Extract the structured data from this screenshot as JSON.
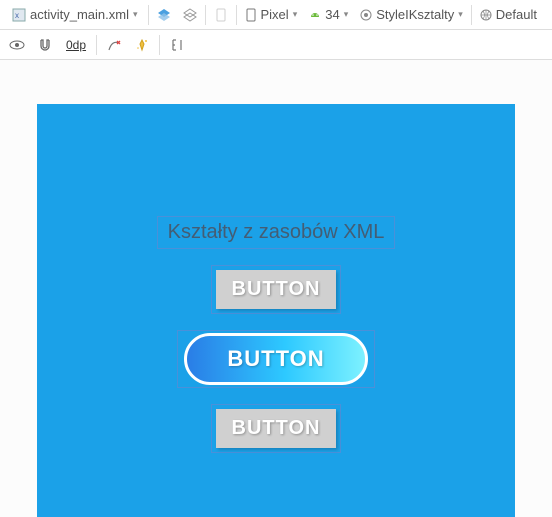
{
  "toolbar": {
    "tab_label": "activity_main.xml",
    "device": "Pixel",
    "api": "34",
    "theme": "StyleIKsztalty",
    "locale": "Default",
    "dp_label": "0dp"
  },
  "preview": {
    "title": "Kształty z zasobów XML",
    "button1": "BUTTON",
    "button2": "BUTTON",
    "button3": "BUTTON"
  }
}
